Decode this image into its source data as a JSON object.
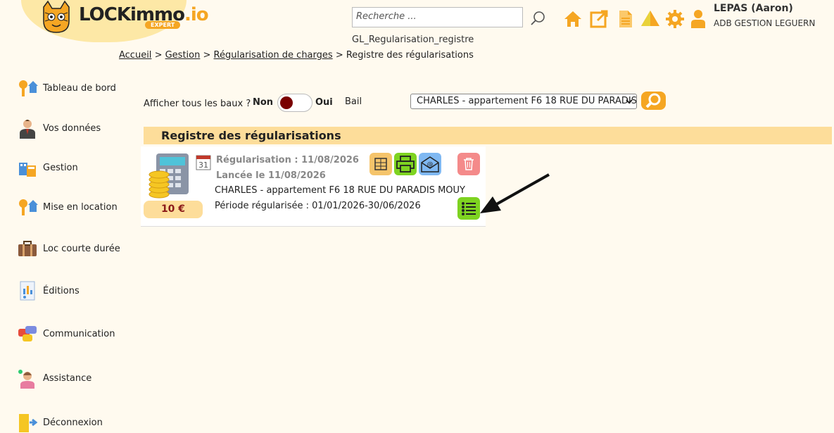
{
  "brand": {
    "name_main": "LOCKimmo",
    "name_suffix": ".io",
    "tagline": "EXPERT",
    "accent": "#f5a623"
  },
  "header": {
    "search_placeholder": "Recherche ...",
    "page_code": "GL_Regularisation_registre",
    "icons": [
      "home-icon",
      "external-link-icon",
      "document-icon",
      "warning-icon",
      "gear-icon",
      "user-icon"
    ],
    "user_name": "LEPAS (Aaron)",
    "user_org": "ADB GESTION LEGUERN"
  },
  "breadcrumb": {
    "home": "Accueil",
    "sep": ">",
    "gestion": "Gestion",
    "regularisation": "Régularisation de charges",
    "current": "Registre des régularisations"
  },
  "sidebar": {
    "items": [
      {
        "label": "Tableau de bord"
      },
      {
        "label": "Vos données"
      },
      {
        "label": "Gestion"
      },
      {
        "label": "Mise en location"
      },
      {
        "label": "Loc courte durée"
      },
      {
        "label": "Éditions"
      },
      {
        "label": "Communication"
      },
      {
        "label": "Assistance"
      },
      {
        "label": "Déconnexion"
      }
    ]
  },
  "filters": {
    "show_all_label": "Afficher tous les baux ?",
    "toggle_off": "Non",
    "toggle_on": "Oui",
    "bail_label": "Bail",
    "bail_selected": "CHARLES - appartement F6 18 RUE DU PARADIS"
  },
  "section": {
    "title": "Registre des régularisations"
  },
  "regularisation": {
    "amount": "10 €",
    "date_icon_day": "31",
    "title": "Régularisation : 11/08/2026",
    "launched": "Lancée le 11/08/2026",
    "bail": "CHARLES - appartement F6 18 RUE DU PARADIS MOUY",
    "period": "Période régularisée : 01/01/2026-30/06/2026"
  }
}
